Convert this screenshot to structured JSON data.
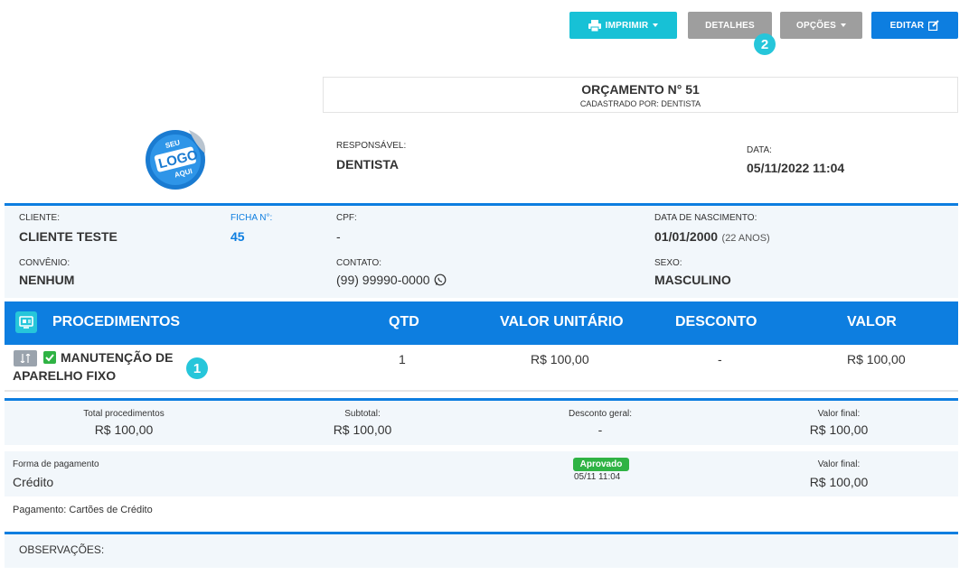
{
  "toolbar": {
    "print_label": "IMPRIMIR",
    "details_label": "DETALHES",
    "options_label": "OPÇÕES",
    "edit_label": "EDITAR"
  },
  "markers": {
    "m1": "1",
    "m2": "2"
  },
  "logo": {
    "line1": "SEU",
    "line2": "LOGO",
    "line3": "AQUI"
  },
  "budget": {
    "title": "ORÇAMENTO N° 51",
    "registered_by": "CADASTRADO POR: DENTISTA",
    "responsible_label": "RESPONSÁVEL:",
    "responsible": "DENTISTA",
    "date_label": "DATA:",
    "date": "05/11/2022 11:04"
  },
  "client": {
    "client_label": "CLIENTE:",
    "client": "CLIENTE TESTE",
    "file_label": "FICHA N°:",
    "file": "45",
    "cpf_label": "CPF:",
    "cpf": "-",
    "birth_label": "DATA DE NASCIMENTO:",
    "birth": "01/01/2000",
    "age": "(22 ANOS)",
    "plan_label": "CONVÊNIO:",
    "plan": "NENHUM",
    "contact_label": "CONTATO:",
    "contact": "(99) 99990-0000",
    "sex_label": "SEXO:",
    "sex": "MASCULINO"
  },
  "procedures": {
    "headers": {
      "name": "PROCEDIMENTOS",
      "qty": "QTD",
      "unit": "VALOR UNITÁRIO",
      "discount": "DESCONTO",
      "value": "VALOR"
    },
    "rows": [
      {
        "name_line1": "MANUTENÇÃO DE",
        "name_line2": "APARELHO FIXO",
        "qty": "1",
        "unit": "R$ 100,00",
        "discount": "-",
        "value": "R$ 100,00"
      }
    ]
  },
  "totals": {
    "total_proc_label": "Total procedimentos",
    "total_proc": "R$ 100,00",
    "subtotal_label": "Subtotal:",
    "subtotal": "R$ 100,00",
    "discount_label": "Desconto geral:",
    "discount": "-",
    "final_label": "Valor final:",
    "final": "R$ 100,00"
  },
  "payment": {
    "method_label": "Forma de pagamento",
    "method": "Crédito",
    "status": "Aprovado",
    "status_date": "05/11 11:04",
    "final_label": "Valor final:",
    "final": "R$ 100,00",
    "note": "Pagamento: Cartões de Crédito"
  },
  "observations": {
    "label": "OBSERVAÇÕES:"
  },
  "colors": {
    "primary": "#0d7ee0",
    "cyan": "#17c1d6",
    "gray": "#9e9e9e",
    "success": "#2fb344",
    "panel": "#f2f7fb"
  }
}
